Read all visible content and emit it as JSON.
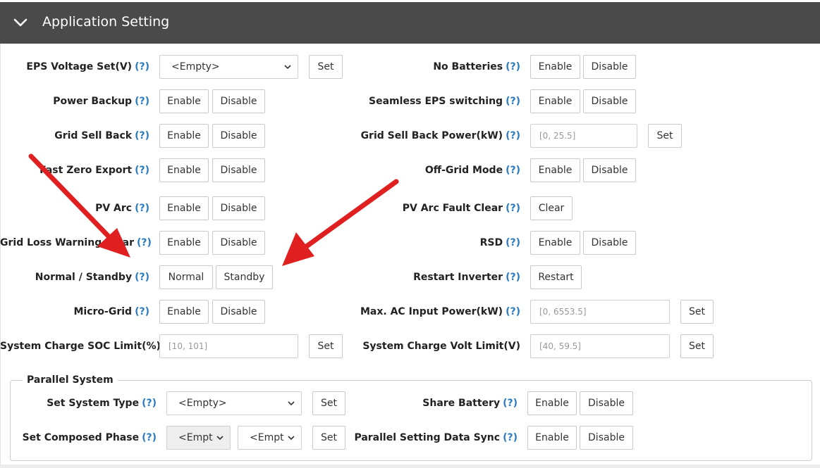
{
  "header": {
    "title": "Application Setting"
  },
  "labels": {
    "help": "(?)",
    "enable": "Enable",
    "disable": "Disable",
    "set": "Set",
    "empty": "<Empty>",
    "empty_short": "<Empt",
    "normal": "Normal",
    "standby": "Standby",
    "clear": "Clear",
    "restart": "Restart"
  },
  "left": {
    "eps_voltage": "EPS Voltage Set(V)",
    "power_backup": "Power Backup",
    "grid_sell_back": "Grid Sell Back",
    "fast_zero_export": "Fast Zero Export",
    "pv_arc": "PV Arc",
    "grid_loss_warning": "Grid Loss Warning Clear",
    "normal_standby": "Normal / Standby",
    "micro_grid": "Micro-Grid",
    "system_charge_soc": "System Charge SOC Limit(%)",
    "system_charge_soc_placeholder": "[10, 101]"
  },
  "right": {
    "no_batteries": "No Batteries",
    "seamless_eps": "Seamless EPS switching",
    "grid_sell_back_power": "Grid Sell Back Power(kW)",
    "grid_sell_back_power_placeholder": "[0, 25.5]",
    "off_grid_mode": "Off-Grid Mode",
    "pv_arc_fault_clear": "PV Arc Fault Clear",
    "rsd": "RSD",
    "restart_inverter": "Restart Inverter",
    "max_ac_input": "Max. AC Input Power(kW)",
    "max_ac_input_placeholder": "[0, 6553.5]",
    "system_charge_volt": "System Charge Volt Limit(V)",
    "system_charge_volt_placeholder": "[40, 59.5]"
  },
  "parallel": {
    "legend": "Parallel System",
    "set_system_type": "Set System Type",
    "set_composed_phase": "Set Composed Phase",
    "share_battery": "Share Battery",
    "parallel_data_sync": "Parallel Setting Data Sync"
  },
  "colors": {
    "header_bg": "#4a4a4a",
    "help": "#2a7bc0",
    "arrow": "#e02020"
  }
}
